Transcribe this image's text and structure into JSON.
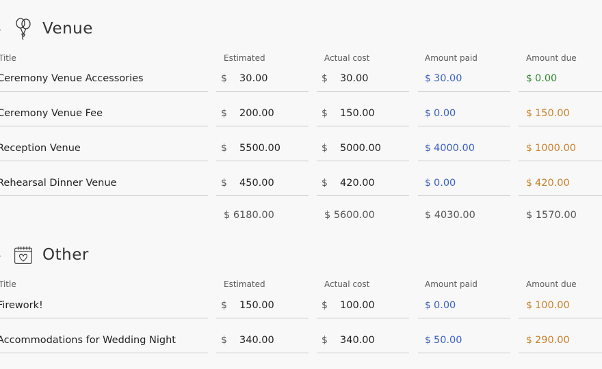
{
  "sections": [
    {
      "title": "Venue",
      "icon": "balloons-icon",
      "columns": {
        "title": "Title",
        "estimated": "Estimated",
        "actual": "Actual cost",
        "paid": "Amount paid",
        "due": "Amount due"
      },
      "rows": [
        {
          "title": "Ceremony Venue Accessories",
          "estimated": "30.00",
          "actual": "30.00",
          "paid": "30.00",
          "due": "0.00",
          "due_status": "green"
        },
        {
          "title": "Ceremony Venue Fee",
          "estimated": "200.00",
          "actual": "150.00",
          "paid": "0.00",
          "due": "150.00",
          "due_status": "orange"
        },
        {
          "title": "Reception Venue",
          "estimated": "5500.00",
          "actual": "5000.00",
          "paid": "4000.00",
          "due": "1000.00",
          "due_status": "orange"
        },
        {
          "title": "Rehearsal Dinner Venue",
          "estimated": "450.00",
          "actual": "420.00",
          "paid": "0.00",
          "due": "420.00",
          "due_status": "orange"
        }
      ],
      "totals": {
        "estimated": "$ 6180.00",
        "actual": "$ 5600.00",
        "paid": "$ 4030.00",
        "due": "$ 1570.00"
      }
    },
    {
      "title": "Other",
      "icon": "calendar-heart-icon",
      "columns": {
        "title": "Title",
        "estimated": "Estimated",
        "actual": "Actual cost",
        "paid": "Amount paid",
        "due": "Amount due"
      },
      "rows": [
        {
          "title": "Firework!",
          "estimated": "150.00",
          "actual": "100.00",
          "paid": "0.00",
          "due": "100.00",
          "due_status": "orange"
        },
        {
          "title": "Accommodations for Wedding Night",
          "estimated": "340.00",
          "actual": "340.00",
          "paid": "50.00",
          "due": "290.00",
          "due_status": "orange"
        }
      ]
    }
  ],
  "currency_symbol": "$",
  "colors": {
    "paid": "#3a5fc0",
    "due_ok": "#2f8a2f",
    "due_pending": "#c8802b"
  }
}
